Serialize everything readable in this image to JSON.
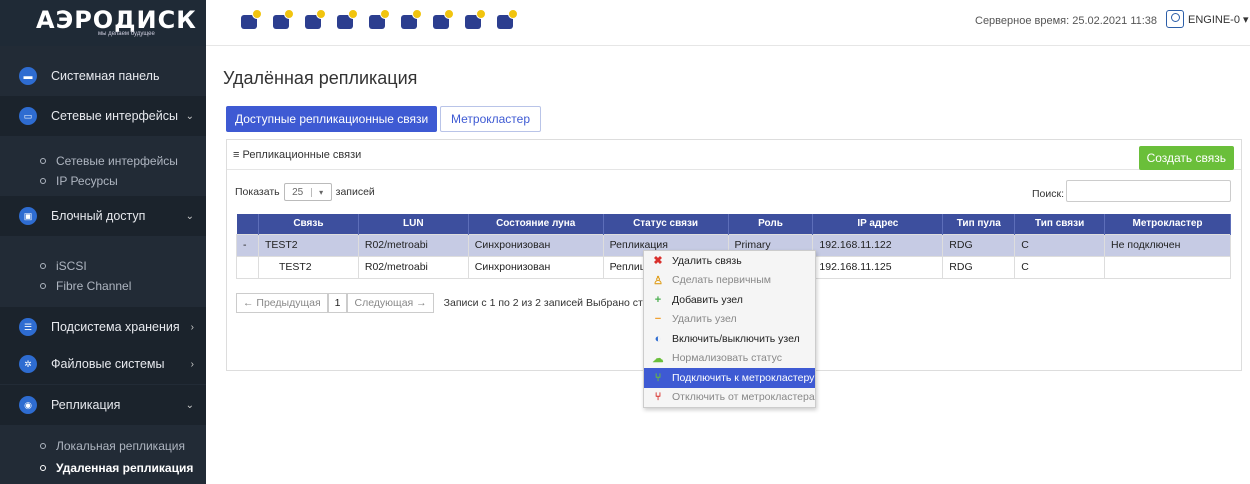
{
  "header": {
    "logo_text": "АЭРОДИСК",
    "logo_sub": "мы делаем будущее",
    "server_time": "Серверное время: 25.02.2021 11:38",
    "engine": "ENGINE-0 ▾",
    "tool_icons": [
      "storage-icon",
      "monitor-icon",
      "server-icon",
      "cluster-icon",
      "pool-icon",
      "network-icon",
      "display-icon",
      "rack-icon",
      "nodes-icon"
    ]
  },
  "sidebar": {
    "items": [
      {
        "label": "Системная панель",
        "icon": "dashboard-icon"
      },
      {
        "label": "Сетевые интерфейсы",
        "arrow": "⌄",
        "icon": "network-icon"
      },
      {
        "label": "Блочный доступ",
        "arrow": "⌄",
        "icon": "block-icon"
      },
      {
        "label": "Подсистема хранения",
        "arrow": "›",
        "icon": "storage-icon"
      },
      {
        "label": "Файловые системы",
        "arrow": "›",
        "icon": "files-icon"
      },
      {
        "label": "Репликация",
        "arrow": "⌄",
        "icon": "replication-icon"
      }
    ],
    "sub_net": [
      "Сетевые интерфейсы",
      "IP Ресурсы"
    ],
    "sub_block": [
      "iSCSI",
      "Fibre Channel"
    ],
    "sub_repl": [
      "Локальная репликация",
      "Удаленная репликация"
    ]
  },
  "main": {
    "title": "Удалённая репликация",
    "tabs": [
      "Доступные репликационные связи",
      "Метрокластер"
    ],
    "panel_title": "≡ Репликационные связи",
    "create_button": "Создать связь",
    "show_prefix": "Показать",
    "show_value": "25",
    "show_suffix": "записей",
    "search_label": "Поиск:",
    "table": {
      "columns": [
        "Связь",
        "LUN",
        "Состояние луна",
        "Статус связи",
        "Роль",
        "IP адрес",
        "Тип пула",
        "Тип связи",
        "Метрокластер"
      ],
      "rows": [
        {
          "prefix": "-",
          "link": "TEST2",
          "lun": "R02/metroabi",
          "state": "Синхронизован",
          "status": "Репликация",
          "role": "Primary",
          "ip": "192.168.11.122",
          "pool": "RDG",
          "type": "C",
          "metro": "Не подключен"
        },
        {
          "prefix": "",
          "link": "TEST2",
          "lun": "R02/metroabi",
          "state": "Синхронизован",
          "status": "Реплиц",
          "role": "",
          "ip": "192.168.11.125",
          "pool": "RDG",
          "type": "C",
          "metro": ""
        }
      ]
    },
    "pager": {
      "prev": "← Предыдущая",
      "page": "1",
      "next": "Следующая →",
      "info": "Записи с 1 по 2 из 2 записей   Выбрано ст"
    }
  },
  "context_menu": {
    "items": [
      {
        "label": "Удалить связь",
        "icon": "✖",
        "icon_name": "delete-icon",
        "color": "#d9302c",
        "state": "normal"
      },
      {
        "label": "Сделать первичным",
        "icon": "♙",
        "icon_name": "make-primary-icon",
        "color": "#e0a020",
        "state": "disabled"
      },
      {
        "label": "Добавить узел",
        "icon": "+",
        "icon_name": "add-icon",
        "color": "#4caf50",
        "state": "normal"
      },
      {
        "label": "Удалить узел",
        "icon": "−",
        "icon_name": "remove-icon",
        "color": "#f0a030",
        "state": "disabled"
      },
      {
        "label": "Включить/выключить узел",
        "icon": "◐",
        "icon_name": "toggle-icon",
        "color": "#2e6cd1",
        "state": "normal"
      },
      {
        "label": "Нормализовать статус",
        "icon": "☁",
        "icon_name": "normalize-icon",
        "color": "#6abf3a",
        "state": "disabled"
      },
      {
        "label": "Подключить к метрокластеру",
        "icon": "⑂",
        "icon_name": "connect-metro-icon",
        "color": "#6abf3a",
        "state": "highlight"
      },
      {
        "label": "Отключить от метрокластера",
        "icon": "⑂",
        "icon_name": "disconnect-metro-icon",
        "color": "#d9302c",
        "state": "disabled"
      }
    ]
  }
}
